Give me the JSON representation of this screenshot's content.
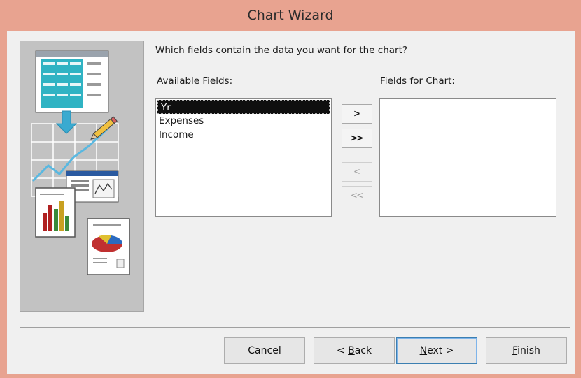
{
  "window": {
    "title": "Chart Wizard"
  },
  "prompt": "Which fields contain the data you want for the chart?",
  "available_fields": {
    "label": "Available Fields:",
    "items": [
      "Yr",
      "Expenses",
      "Income"
    ],
    "selected": "Yr"
  },
  "chart_fields": {
    "label": "Fields for Chart:",
    "items": []
  },
  "move_buttons": {
    "add_one": ">",
    "add_all": ">>",
    "remove_one": "<",
    "remove_all": "<<"
  },
  "footer": {
    "cancel": "Cancel",
    "back_prefix": "< ",
    "back_mnemonic": "B",
    "back_rest": "ack",
    "next_mnemonic": "N",
    "next_rest": "ext >",
    "finish_mnemonic": "F",
    "finish_rest": "inish"
  },
  "colors": {
    "title_bar": "#e8a390",
    "client_bg": "#f0f0f0",
    "illustration_bg": "#c2c2c2",
    "selection": "#0f0f0f",
    "default_button_border": "#3c7fb1"
  }
}
